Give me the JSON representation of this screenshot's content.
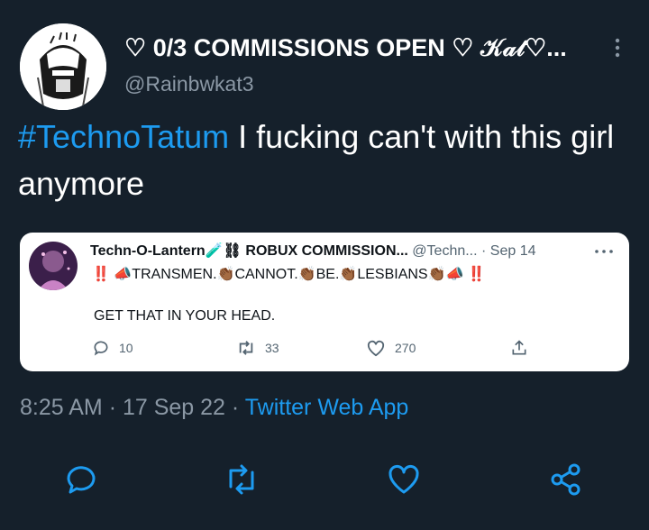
{
  "author": {
    "display_name": "♡ 0/3 COMMISSIONS OPEN ♡ 𝒦𝒶𝓉♡...",
    "handle": "@Rainbwkat3"
  },
  "tweet": {
    "hashtag": "#TechnoTatum",
    "text": " I fucking can't with this girl anymore"
  },
  "quote": {
    "name": "Techn-O-Lantern🧪⛓ ROBUX COMMISSION...",
    "handle": "@Techn...",
    "date": "· Sep 14",
    "line1_prefix": "‼️",
    "line1_words": [
      "📣TRANSMEN.",
      "👏🏾CANNOT.",
      "👏🏾BE.",
      "👏🏾LESBIANS👏🏾📣"
    ],
    "line1_suffix": "‼️",
    "line2": "GET THAT IN YOUR HEAD.",
    "replies": "10",
    "retweets": "33",
    "likes": "270"
  },
  "meta": {
    "time": "8:25 AM",
    "date": "17 Sep 22",
    "separator": "·",
    "source": "Twitter Web App"
  },
  "colors": {
    "background": "#15202b",
    "accent": "#1d9bf0",
    "secondary_text": "#8b98a5"
  },
  "icons": {
    "reply": "reply-icon",
    "retweet": "retweet-icon",
    "like": "like-icon",
    "share": "share-icon"
  }
}
